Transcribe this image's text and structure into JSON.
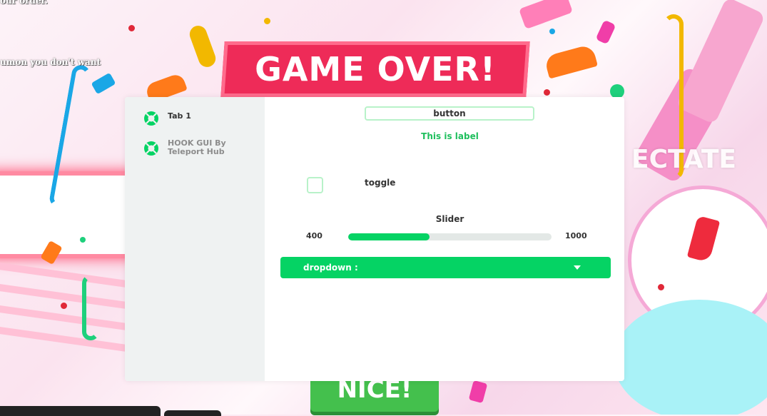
{
  "game": {
    "banner": "GAME OVER!",
    "spectate": "ECTATE",
    "nice_button": "NICE!",
    "chat": {
      "line1": "our order.",
      "line2": "umon you don't want"
    }
  },
  "gui": {
    "tabs": [
      {
        "label": "Tab 1",
        "icon": "lifebuoy-icon"
      },
      {
        "label": "HOOK GUI By Teleport Hub",
        "icon": "lifebuoy-icon"
      }
    ],
    "button_label": "button",
    "label_text": "This is label",
    "toggle": {
      "label": "toggle",
      "checked": false
    },
    "slider": {
      "title": "Slider",
      "min": "400",
      "max": "1000",
      "fraction": 0.4
    },
    "dropdown": {
      "label": "dropdown :"
    }
  },
  "colors": {
    "accent": "#05d364",
    "banner": "#ee2b58",
    "sidebar": "#eff2f2"
  }
}
